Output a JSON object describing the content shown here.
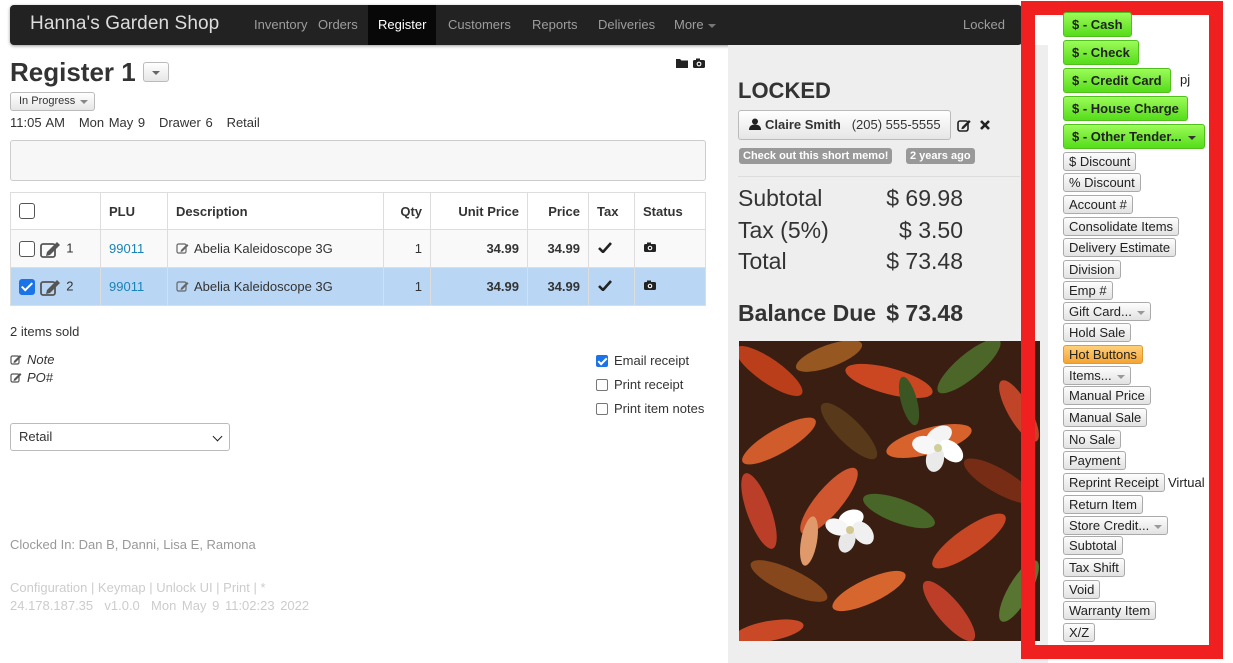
{
  "navbar": {
    "brand": "Hanna's Garden Shop",
    "items": [
      "Inventory",
      "Orders",
      "Register",
      "Customers",
      "Reports",
      "Deliveries",
      "More"
    ],
    "active": "Register",
    "locked": "Locked"
  },
  "register": {
    "title": "Register 1",
    "status": "In Progress",
    "time": "11:05 AM",
    "date": "Mon May 9",
    "drawer": "Drawer 6",
    "mode": "Retail"
  },
  "table": {
    "headers": [
      "PLU",
      "Description",
      "Qty",
      "Unit Price",
      "Price",
      "Tax",
      "Status"
    ],
    "rows": [
      {
        "line": "1",
        "plu": "99011",
        "description": "Abelia Kaleidoscope 3G",
        "qty": "1",
        "unit_price": "34.99",
        "price": "34.99",
        "selected": false
      },
      {
        "line": "2",
        "plu": "99011",
        "description": "Abelia Kaleidoscope 3G",
        "qty": "1",
        "unit_price": "34.99",
        "price": "34.99",
        "selected": true
      }
    ]
  },
  "summary": {
    "items_sold": "2 items sold",
    "note": "Note",
    "po": "PO#",
    "email_receipt": "Email receipt",
    "print_receipt": "Print receipt",
    "print_item_notes": "Print item notes",
    "sale_type": "Retail"
  },
  "footer": {
    "clocked_in": "Clocked In: Dan B, Danni, Lisa E, Ramona",
    "links": "Configuration | Keymap | Unlock UI | Print | *",
    "ip": "24.178.187.35",
    "version": "v1.0.0",
    "timestamp": "Mon May 9 11:02:23 2022"
  },
  "panel": {
    "locked_title": "LOCKED",
    "customer_name": "Claire Smith",
    "customer_phone": "(205) 555-5555",
    "memo_badge": "Check out this short memo!",
    "age_badge": "2 years ago",
    "subtotal_label": "Subtotal",
    "subtotal": "$ 69.98",
    "tax_label": "Tax (5%)",
    "tax": "$ 3.50",
    "total_label": "Total",
    "total": "$ 73.48",
    "balance_label": "Balance Due",
    "balance": "$ 73.48"
  },
  "tenders": {
    "cash": "$ - Cash",
    "check": "$ - Check",
    "credit_card": "$ - Credit Card",
    "credit_card_note": "pj",
    "house_charge": "$ - House Charge",
    "other": "$ - Other Tender..."
  },
  "actions": {
    "discount": "$ Discount",
    "pct_discount": "% Discount",
    "account": "Account #",
    "consolidate": "Consolidate Items",
    "delivery": "Delivery Estimate",
    "division": "Division",
    "emp": "Emp #",
    "gift_card": "Gift Card...",
    "hold_sale": "Hold Sale",
    "hot_buttons": "Hot Buttons",
    "items": "Items...",
    "manual_price": "Manual Price",
    "manual_sale": "Manual Sale",
    "no_sale": "No Sale",
    "payment": "Payment",
    "reprint_receipt": "Reprint Receipt",
    "reprint_note": "Virtual",
    "return_item": "Return Item",
    "store_credit": "Store Credit...",
    "subtotal": "Subtotal",
    "tax_shift": "Tax Shift",
    "void": "Void",
    "warranty": "Warranty Item",
    "xz": "X/Z"
  },
  "colors": {
    "tender_green": "#7ded3a",
    "hot_orange": "#f5b04c",
    "frame_red": "#f02020",
    "selected_row": "#b9d6f5"
  }
}
